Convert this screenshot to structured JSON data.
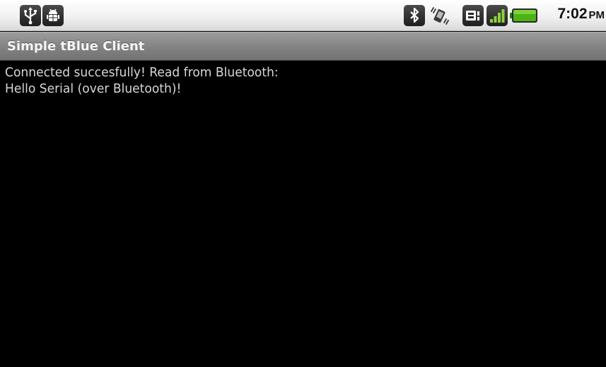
{
  "status_bar": {
    "notifications": [
      {
        "icon": "usb-icon"
      },
      {
        "icon": "android-debug-icon"
      }
    ],
    "system_icons": [
      {
        "icon": "bluetooth-icon"
      },
      {
        "icon": "vibrate-icon"
      },
      {
        "icon": "data-transfer-icon"
      },
      {
        "icon": "signal-strength-icon"
      },
      {
        "icon": "battery-icon"
      }
    ],
    "time": "7:02",
    "ampm": "PM",
    "battery_color": "#3ea10f"
  },
  "app": {
    "title": "Simple tBlue Client"
  },
  "output": {
    "text": "Connected succesfully! Read from Bluetooth:\nHello Serial (over Bluetooth)!"
  }
}
